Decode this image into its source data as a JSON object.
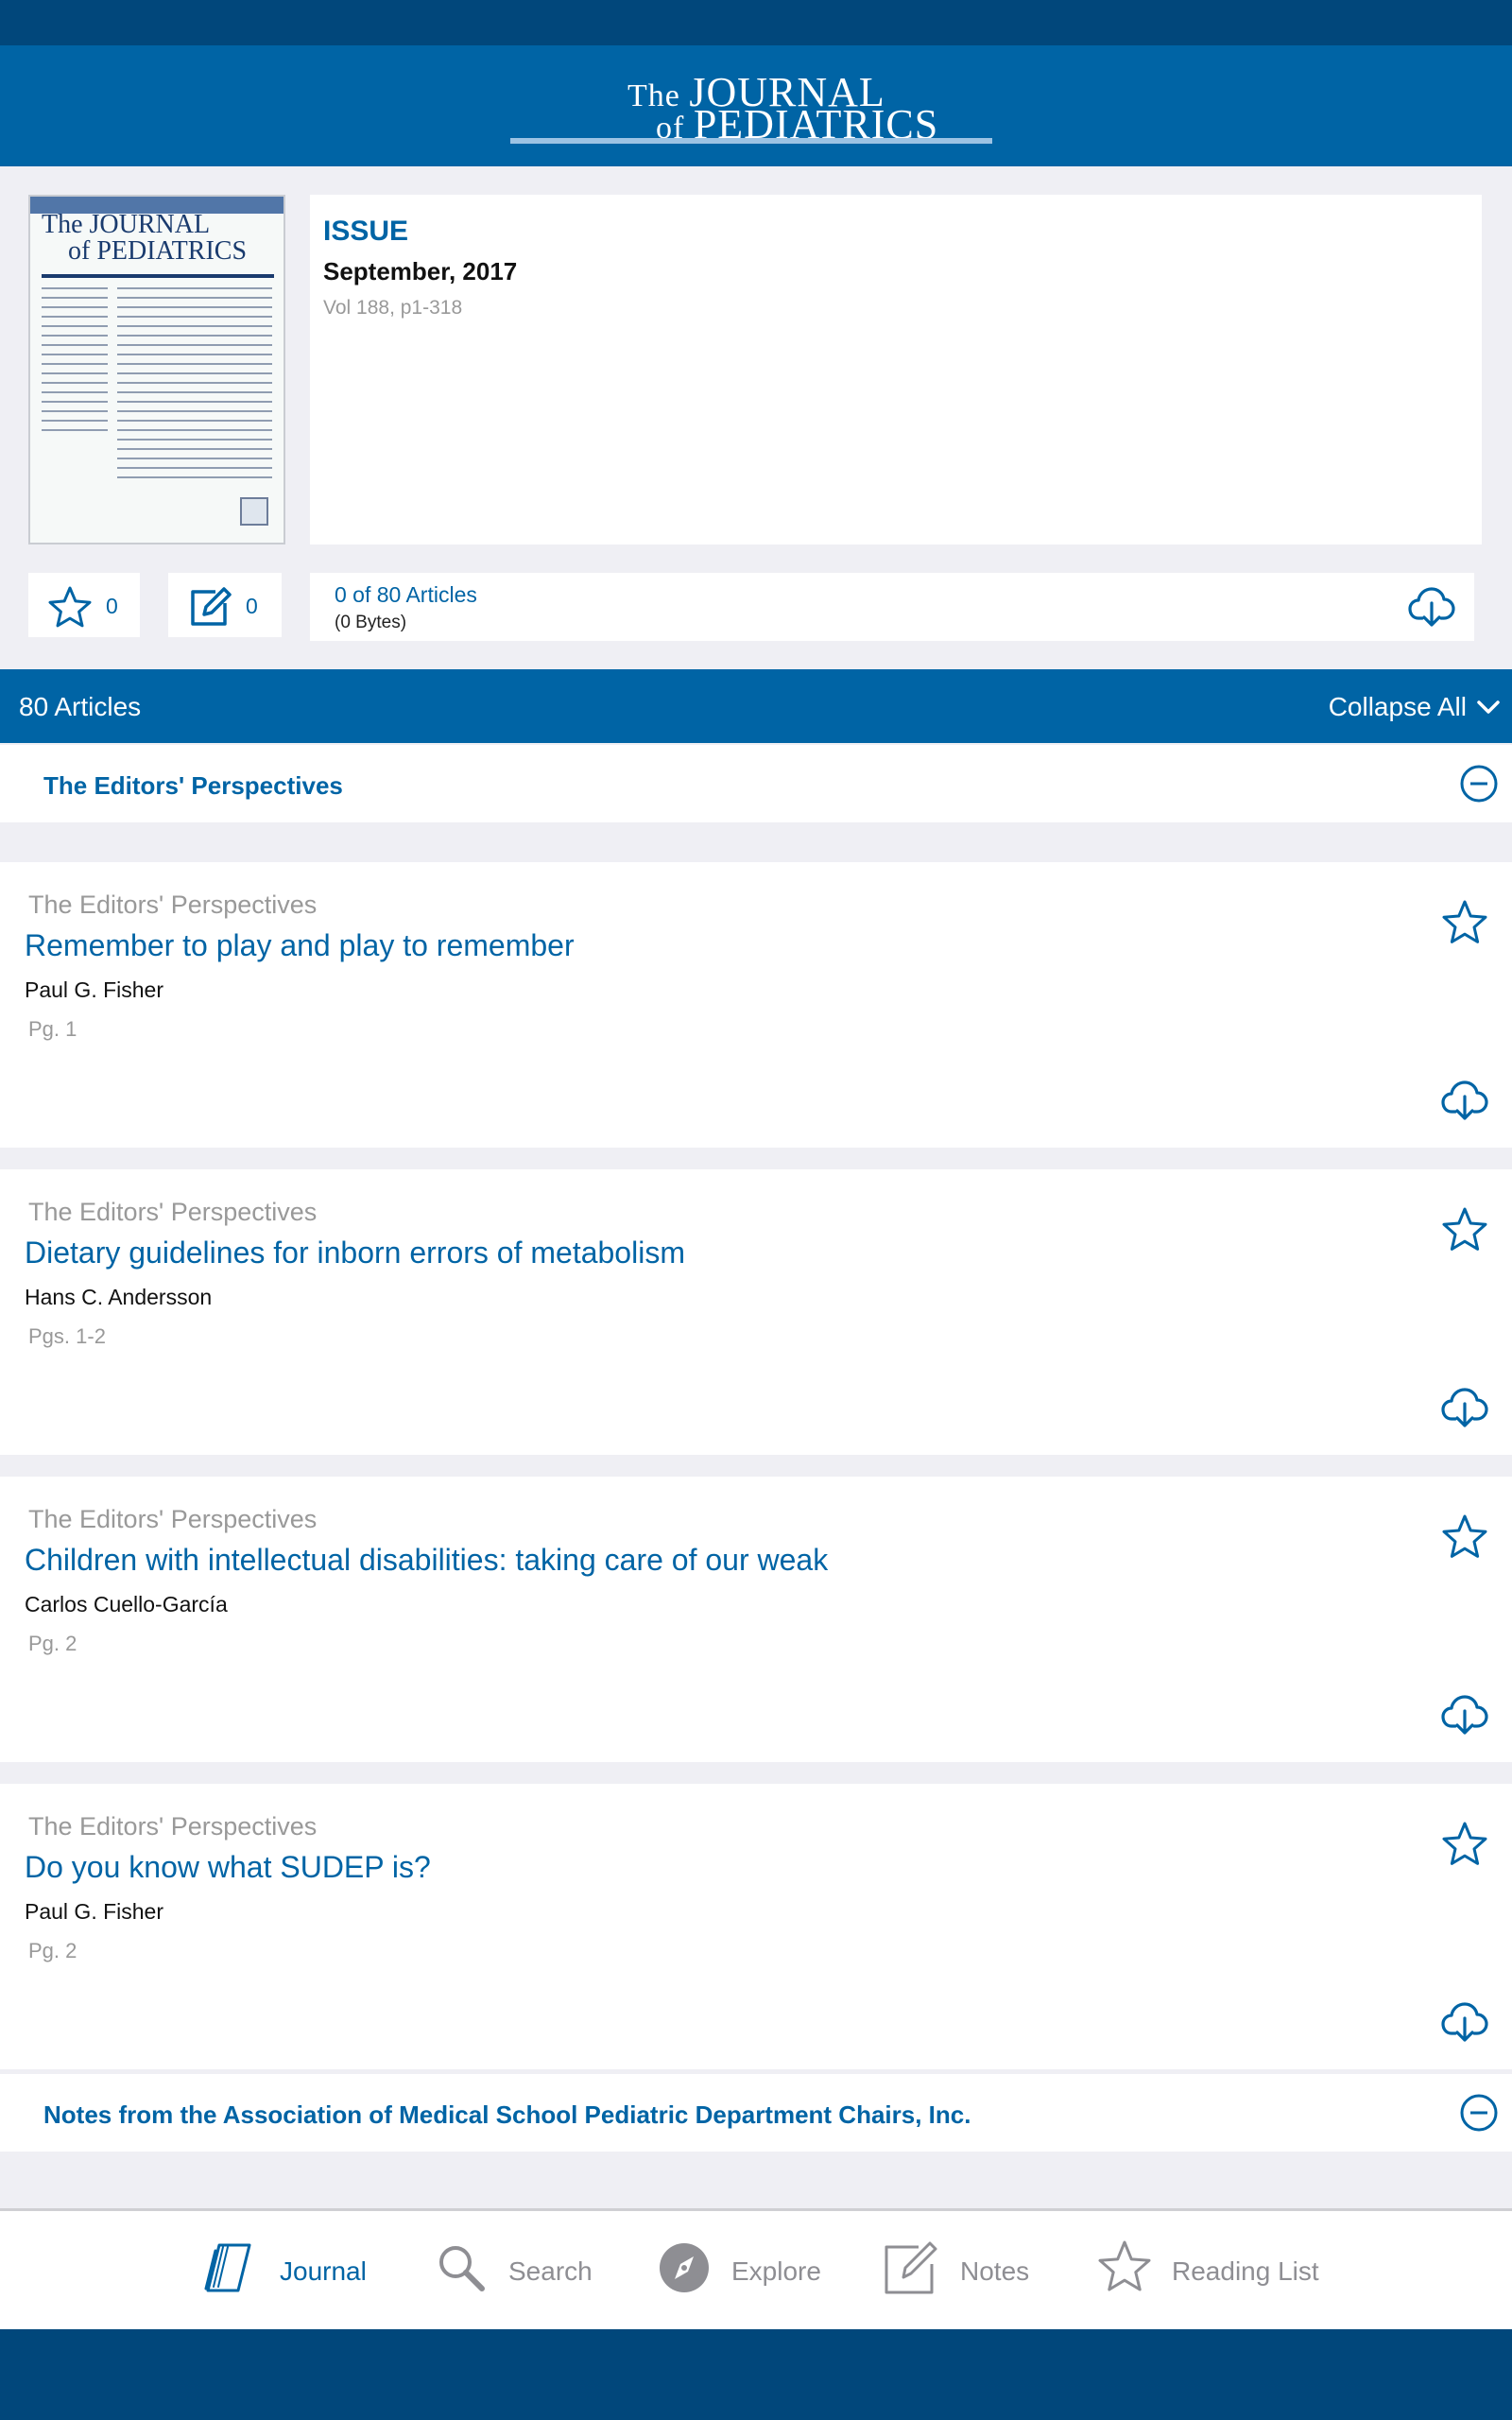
{
  "app": {
    "logo_the": "The",
    "logo_journal": "JOURNAL",
    "logo_of": "of",
    "logo_pediatrics": "PEDIATRICS"
  },
  "cover": {
    "title_line1": "The JOURNAL",
    "title_line2": "of PEDIATRICS"
  },
  "issue": {
    "label": "ISSUE",
    "date": "September, 2017",
    "volume": "Vol 188, p1-318"
  },
  "counters": {
    "favorites": "0",
    "notes": "0"
  },
  "download": {
    "articles": "0 of 80 Articles",
    "size": "(0 Bytes)"
  },
  "articles_header": {
    "count": "80 Articles",
    "collapse": "Collapse All"
  },
  "sections": [
    {
      "title": "The Editors' Perspectives",
      "articles": [
        {
          "category": "The Editors' Perspectives",
          "title": "Remember to play and play to remember",
          "author": "Paul G. Fisher",
          "pages": "Pg. 1"
        },
        {
          "category": "The Editors' Perspectives",
          "title": "Dietary guidelines for inborn errors of metabolism",
          "author": "Hans C. Andersson",
          "pages": "Pgs. 1-2"
        },
        {
          "category": "The Editors' Perspectives",
          "title": "Children with intellectual disabilities: taking care of our weak",
          "author": "Carlos Cuello-García",
          "pages": "Pg. 2"
        },
        {
          "category": "The Editors' Perspectives",
          "title": "Do you know what SUDEP is?",
          "author": "Paul G. Fisher",
          "pages": "Pg. 2"
        }
      ]
    },
    {
      "title": "Notes from the Association of Medical School Pediatric Department Chairs, Inc."
    }
  ],
  "tabs": [
    {
      "label": "Journal",
      "icon": "journal-icon",
      "active": true
    },
    {
      "label": "Search",
      "icon": "search-icon",
      "active": false
    },
    {
      "label": "Explore",
      "icon": "compass-icon",
      "active": false
    },
    {
      "label": "Notes",
      "icon": "notes-icon",
      "active": false
    },
    {
      "label": "Reading List",
      "icon": "star-icon",
      "active": false
    }
  ],
  "colors": {
    "brand_blue": "#0064a5",
    "dark_blue": "#01477b",
    "muted_gray": "#8e8e93",
    "background": "#efeff4"
  }
}
